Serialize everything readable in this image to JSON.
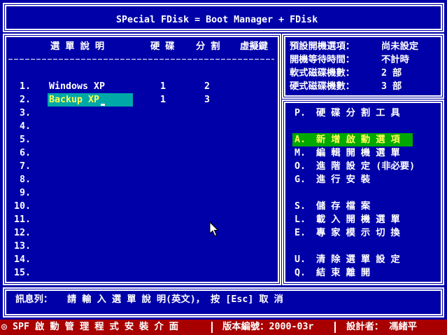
{
  "title": "SPecial FDisk = Boot Manager + FDisk",
  "boot_list": {
    "headers": {
      "description": "選 單 說 明",
      "disk": "硬 碟",
      "partition": "分 割",
      "hotkey": "虛擬鍵"
    },
    "rows": [
      {
        "number": "1.",
        "description": "Windows XP",
        "disk": "1",
        "partition": "2"
      },
      {
        "number": "2.",
        "description": "Backup XP",
        "disk": "1",
        "partition": "3",
        "editing": true
      },
      {
        "number": "3."
      },
      {
        "number": "4."
      },
      {
        "number": "5."
      },
      {
        "number": "6."
      },
      {
        "number": "7."
      },
      {
        "number": "8."
      },
      {
        "number": "9."
      },
      {
        "number": "10."
      },
      {
        "number": "11."
      },
      {
        "number": "12."
      },
      {
        "number": "13."
      },
      {
        "number": "14."
      },
      {
        "number": "15."
      }
    ]
  },
  "boot_settings": [
    {
      "label": "預設開機選項：",
      "value": "尚未設定"
    },
    {
      "label": "開機等待時間：",
      "value": "不計時"
    },
    {
      "label": "軟式磁碟機數：",
      "value": "2 部"
    },
    {
      "label": "硬式磁碟機數：",
      "value": "3 部"
    }
  ],
  "menu": [
    {
      "key": "P.",
      "label": "硬 碟 分 割 工 具"
    },
    {
      "key": "A.",
      "label": "新 增 啟 動 選 項",
      "selected": true
    },
    {
      "key": "M.",
      "label": "編 輯 開 機 選 單"
    },
    {
      "key": "O.",
      "label": "進 階 設 定 (非必要)"
    },
    {
      "key": "G.",
      "label": "進 行 安 裝"
    },
    {
      "key": "S.",
      "label": "儲 存 檔 案"
    },
    {
      "key": "L.",
      "label": "載 入 開 機 選 單"
    },
    {
      "key": "E.",
      "label": "專 家 模 示 切 換"
    },
    {
      "key": "U.",
      "label": "清 除 選 單 設 定"
    },
    {
      "key": "Q.",
      "label": "結 束 離 開"
    }
  ],
  "message_bar": {
    "label": "訊息列：",
    "text": "請 輸 入 選 單 說 明(英文)， 按 [Esc] 取 消"
  },
  "status_bar": {
    "program": "◎ SPF 啟 動 管 理 程 式 安 裝 介 面",
    "version": "版本編號：2000-03r",
    "designer": "設計者： 馮緒平"
  },
  "icons": {
    "pointer": "mouse-pointer-icon"
  },
  "colors": {
    "background": "#0000a8",
    "text": "#ffffff",
    "input_highlight": "#00a8a8",
    "menu_highlight": "#00a800",
    "highlight_text": "#ffff54",
    "status_bar": "#a80000"
  }
}
